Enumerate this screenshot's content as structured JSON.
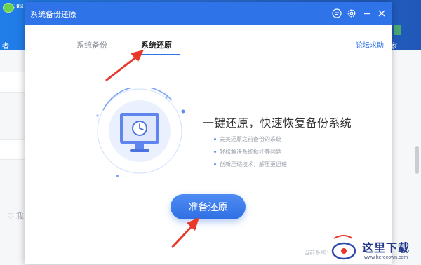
{
  "background_app": {
    "brand": "360",
    "left_fragment": "者",
    "right_fragment": "家",
    "like_fragment": "♡ 我"
  },
  "dialog": {
    "title": "系统备份还原",
    "controls": [
      "message-icon",
      "gear-icon",
      "minimize-icon",
      "close-icon"
    ],
    "tabs": [
      {
        "label": "系统备份",
        "active": false
      },
      {
        "label": "系统还原",
        "active": true
      }
    ],
    "forum_link": "论坛求助",
    "headline": "一键还原，快速恢复备份系统",
    "features": [
      "完美还原之前备份的系统",
      "轻松解决系统损坏等问题",
      "创新压缩技术，解压更迅速"
    ],
    "primary_button": "准备还原",
    "current_system_label": "当前系统："
  },
  "watermark": {
    "cn": "这里下载",
    "url": "www.herecown.com"
  },
  "colors": {
    "accent": "#2f73e8",
    "annotation": "#e8382b"
  }
}
